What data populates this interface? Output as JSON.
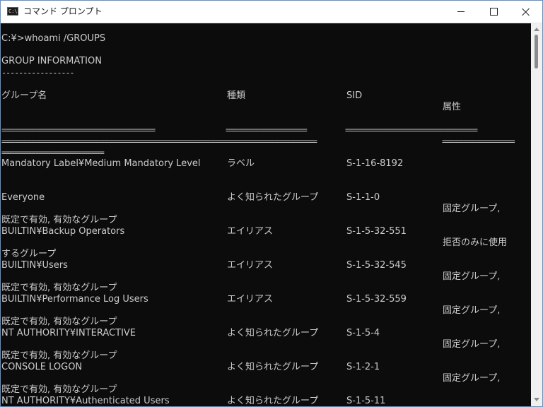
{
  "window": {
    "title": "コマンド プロンプト",
    "icon": "cmd-icon",
    "icon_glyph": "C:\\",
    "controls": [
      "minimize-icon",
      "maximize-icon",
      "close-icon"
    ]
  },
  "console": {
    "command": "C:¥>whoami /GROUPS",
    "section_title": "GROUP INFORMATION",
    "section_underline": "-----------------",
    "columns": {
      "name": "グループ名",
      "type": "種類",
      "sid": "SID",
      "attributes": "属性"
    },
    "separators": {
      "row1_a": "====================================",
      "row1_b": "===================",
      "row1_c": "===============================",
      "row2_a": "==========================================================================",
      "row2_b": "=================",
      "row3": "========================"
    },
    "groups": [
      {
        "name": "Mandatory Label¥Medium Mandatory Level",
        "type": "ラベル",
        "sid": "S-1-16-8192",
        "attr": "",
        "prev_tail": ""
      },
      {
        "name": "Everyone",
        "type": "よく知られたグループ",
        "sid": "S-1-1-0",
        "attr": "固定グループ,",
        "prev_tail": ""
      },
      {
        "name": "BUILTIN¥Backup Operators",
        "type": "エイリアス",
        "sid": "S-1-5-32-551",
        "attr": "拒否のみに使用",
        "prev_tail": "既定で有効, 有効なグループ"
      },
      {
        "name": "BUILTIN¥Users",
        "type": "エイリアス",
        "sid": "S-1-5-32-545",
        "attr": "固定グループ,",
        "prev_tail": "するグループ"
      },
      {
        "name": "BUILTIN¥Performance Log Users",
        "type": "エイリアス",
        "sid": "S-1-5-32-559",
        "attr": "固定グループ,",
        "prev_tail": "既定で有効, 有効なグループ"
      },
      {
        "name": "NT AUTHORITY¥INTERACTIVE",
        "type": "よく知られたグループ",
        "sid": "S-1-5-4",
        "attr": "固定グループ,",
        "prev_tail": "既定で有効, 有効なグループ"
      },
      {
        "name": "CONSOLE LOGON",
        "type": "よく知られたグループ",
        "sid": "S-1-2-1",
        "attr": "固定グループ,",
        "prev_tail": "既定で有効, 有効なグループ"
      },
      {
        "name": "NT AUTHORITY¥Authenticated Users",
        "type": "よく知られたグループ",
        "sid": "S-1-5-11",
        "attr": "",
        "prev_tail": "既定で有効, 有効なグループ"
      }
    ]
  },
  "colors": {
    "console_bg": "#0c0c0c",
    "console_fg": "#cccccc",
    "titlebar_bg": "#ffffff",
    "window_border": "#6d8fb3"
  }
}
